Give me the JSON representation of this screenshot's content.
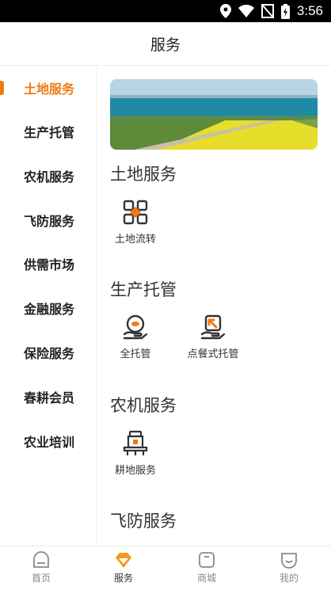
{
  "status_bar": {
    "time": "3:56"
  },
  "header": {
    "title": "服务"
  },
  "sidebar": {
    "items": [
      {
        "label": "土地服务",
        "active": true
      },
      {
        "label": "生产托管"
      },
      {
        "label": "农机服务"
      },
      {
        "label": "飞防服务"
      },
      {
        "label": "供需市场"
      },
      {
        "label": "金融服务"
      },
      {
        "label": "保险服务"
      },
      {
        "label": "春耕会员"
      },
      {
        "label": "农业培训"
      }
    ]
  },
  "sections": [
    {
      "title": "土地服务",
      "items": [
        {
          "label": "土地流转",
          "icon": "land-transfer-icon"
        }
      ]
    },
    {
      "title": "生产托管",
      "items": [
        {
          "label": "全托管",
          "icon": "full-custody-icon"
        },
        {
          "label": "点餐式托管",
          "icon": "menu-custody-icon"
        }
      ]
    },
    {
      "title": "农机服务",
      "items": [
        {
          "label": "耕地服务",
          "icon": "tractor-icon"
        }
      ]
    },
    {
      "title": "飞防服务",
      "items": []
    }
  ],
  "tabbar": {
    "items": [
      {
        "label": "首页",
        "icon": "home-icon"
      },
      {
        "label": "服务",
        "icon": "service-icon",
        "active": true
      },
      {
        "label": "商城",
        "icon": "shop-icon"
      },
      {
        "label": "我的",
        "icon": "profile-icon"
      }
    ]
  },
  "colors": {
    "accent": "#f07a12",
    "text": "#222222"
  }
}
